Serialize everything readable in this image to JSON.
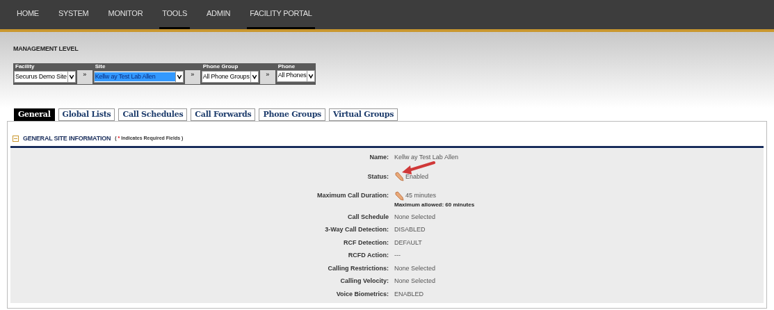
{
  "nav": [
    {
      "label": "HOME",
      "underlined": false
    },
    {
      "label": "SYSTEM",
      "underlined": false
    },
    {
      "label": "MONITOR",
      "underlined": false
    },
    {
      "label": "TOOLS",
      "underlined": true
    },
    {
      "label": "ADMIN",
      "underlined": false
    },
    {
      "label": "FACILITY PORTAL",
      "underlined": true
    }
  ],
  "management": {
    "title": "MANAGEMENT LEVEL",
    "selectors": [
      {
        "label": "Facility",
        "value": "Securus Demo Site",
        "highlighted": false
      },
      {
        "label": "Site",
        "value": "Kellw ay Test Lab Allen",
        "highlighted": true
      },
      {
        "label": "Phone Group",
        "value": "All Phone Groups",
        "highlighted": false
      },
      {
        "label": "Phone",
        "value": "All Phones",
        "highlighted": false
      }
    ],
    "next_button": "»"
  },
  "tabs": [
    {
      "label": "General",
      "selected": true
    },
    {
      "label": "Global Lists",
      "selected": false
    },
    {
      "label": "Call Schedules",
      "selected": false
    },
    {
      "label": "Call Forwards",
      "selected": false
    },
    {
      "label": "Phone Groups",
      "selected": false
    },
    {
      "label": "Virtual Groups",
      "selected": false
    }
  ],
  "section": {
    "title": "GENERAL SITE INFORMATION",
    "note_open": "(",
    "asterisk": "*",
    "note": "Indicates Required Fields )",
    "expanded": true
  },
  "fields": [
    {
      "label": "Name:",
      "value": "Kellw ay Test Lab Allen",
      "editable": false
    },
    {
      "label": "Status:",
      "value": "Enabled",
      "editable": true
    },
    {
      "label": "Maximum Call Duration:",
      "value": "45 minutes",
      "editable": true,
      "note": "Maximum allowed: 60 minutes"
    },
    {
      "label": "Call Schedule",
      "value": "None Selected",
      "editable": false
    },
    {
      "label": "3-Way Call Detection:",
      "value": "DISABLED",
      "editable": false
    },
    {
      "label": "RCF Detection:",
      "value": "DEFAULT",
      "editable": false
    },
    {
      "label": "RCFD Action:",
      "value": "---",
      "editable": false
    },
    {
      "label": "Calling Restrictions:",
      "value": "None Selected",
      "editable": false
    },
    {
      "label": "Calling Velocity:",
      "value": "None Selected",
      "editable": false
    },
    {
      "label": "Voice Biometrics:",
      "value": "ENABLED",
      "editable": false
    }
  ]
}
